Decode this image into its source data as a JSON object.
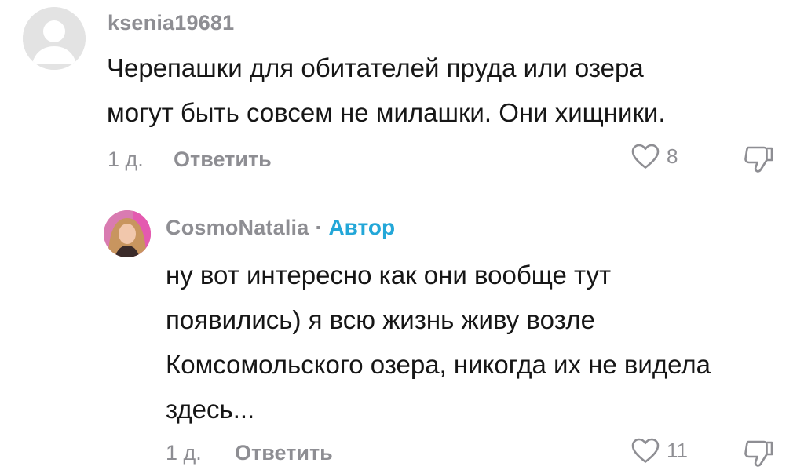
{
  "comments": [
    {
      "username": "ksenia19681",
      "text_line1": "Черепашки для обитателей пруда или озера",
      "text_line2": "могут быть совсем не милашки. Они хищники.",
      "age": "1 д.",
      "reply_label": "Ответить",
      "likes": "8"
    },
    {
      "username": "CosmoNatalia",
      "separator": "·",
      "badge": "Автор",
      "text_line1": "ну вот интересно как они вообще тут",
      "text_line2": "появились) я всю жизнь живу возле",
      "text_line3": "Комсомольского озера, никогда их не видела",
      "text_line4": "здесь...",
      "age": "1 д.",
      "reply_label": "Ответить",
      "likes": "11"
    }
  ],
  "colors": {
    "text": "#161616",
    "muted": "#8e8e93",
    "author_badge": "#23a7d8",
    "avatar_placeholder": "#e3e3e3"
  },
  "icons": [
    "default-avatar-icon",
    "heart-icon",
    "dislike-icon"
  ]
}
